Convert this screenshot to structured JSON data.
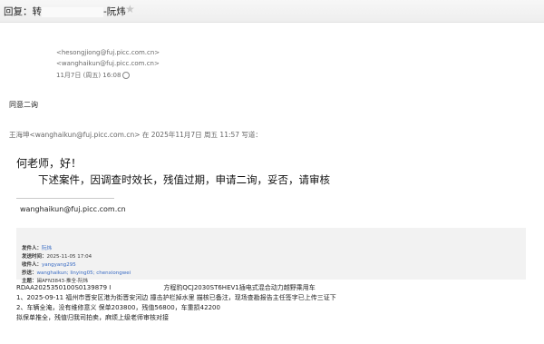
{
  "header": {
    "subject_prefix": "回复：转",
    "subject_suffix": "-阮炜",
    "star": "★"
  },
  "recipients": {
    "line1": "<hesongjiong@fuj.picc.com.cn>",
    "line2": "<wanghaikun@fuj.picc.com.cn>",
    "date": "11月7日 (周五) 16:08"
  },
  "reply": {
    "text": "同意二询"
  },
  "quote": {
    "header": "王海坤<wanghaikun@fuj.picc.com.cn> 在 2025年11月7日 周五 11:57 写道：",
    "greeting": "何老师，好！",
    "body": "下述案件，因调查时效长，残值过期，申请二询，妥否，请审核",
    "signature_email": "wanghaikun@fuj.picc.com.cn"
  },
  "forward": {
    "from_label": "发件人：",
    "from_value": "阮炜",
    "time_label": "发送时间：",
    "time_value": "2025-11-05 17:04",
    "to_label": "收件人：",
    "to_value": "yangyang295",
    "cc_label": "抄送：",
    "cc_value": "wanghaikun; linying05; chenxiongwei",
    "subject_label": "主题：",
    "subject_value": "闽AFN3843-推全-阮炜"
  },
  "content": {
    "line1": "RDAA2025350100S0139879 I",
    "line1b": "方程豹QCJ2030ST6HEV1插电式混合动力越野乘用车",
    "line2": "1、2025-09-11 福州市晋安区港为街晋安河边 撞击护栏掉水里   描核已备注，现场查勘报告主任签字已上传三证下",
    "line3": "2、车辆全淹，没有维修意义  保单203800，残值56800，车重损42200",
    "line4": "拟保单推全，残值归我司拍卖，麻烦上级老师审核对接"
  }
}
